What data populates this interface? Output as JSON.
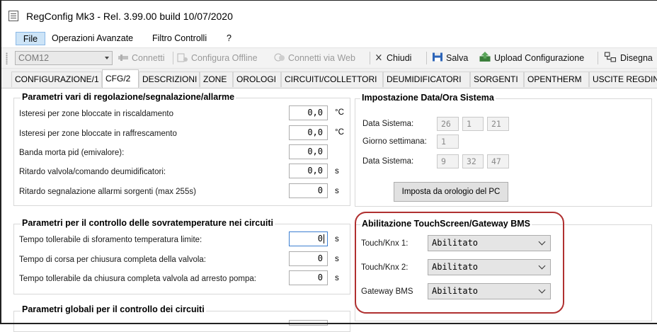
{
  "window": {
    "title": "RegConfig Mk3 - Rel. 3.99.00 build 10/07/2020"
  },
  "menu": {
    "items": [
      "File",
      "Operazioni Avanzate",
      "Filtro Controlli",
      "?"
    ]
  },
  "toolbar": {
    "port_value": "COM12",
    "connect": "Connetti",
    "configure_offline": "Configura Offline",
    "connect_web": "Connetti via Web",
    "close": "Chiudi",
    "save": "Salva",
    "upload": "Upload Configurazione",
    "draw": "Disegna"
  },
  "tabs": [
    "CONFIGURAZIONE/1",
    "CFG/2",
    "DESCRIZIONI",
    "ZONE",
    "OROLOGI",
    "CIRCUITI/COLLETTORI",
    "DEUMIDIFICATORI",
    "SORGENTI",
    "OPENTHERM",
    "USCITE REGDIN"
  ],
  "active_tab": "CFG/2",
  "group_params": {
    "title": "Parametri vari di regolazione/segnalazione/allarme",
    "rows": [
      {
        "label": "Isteresi per zone bloccate in riscaldamento",
        "value": "0,0",
        "unit": "°C"
      },
      {
        "label": "Isteresi per zone bloccate in raffrescamento",
        "value": "0,0",
        "unit": "°C"
      },
      {
        "label": "Banda morta pid (emivalore):",
        "value": "0,0",
        "unit": ""
      },
      {
        "label": "Ritardo valvola/comando deumidificatori:",
        "value": "0,0",
        "unit": "s"
      },
      {
        "label": "Ritardo segnalazione allarmi sorgenti (max 255s)",
        "value": "0",
        "unit": "s"
      }
    ]
  },
  "group_overtemp": {
    "title": "Parametri per il controllo delle sovratemperature nei circuiti",
    "rows": [
      {
        "label": "Tempo tollerabile di sforamento temperatura limite:",
        "value": "0",
        "unit": "s"
      },
      {
        "label": "Tempo di corsa per chiusura completa della valvola:",
        "value": "0",
        "unit": "s"
      },
      {
        "label": "Tempo tollerabile da chiusura completa valvola ad arresto pompa:",
        "value": "0",
        "unit": "s"
      }
    ]
  },
  "group_global": {
    "title": "Parametri globali per il controllo dei circuiti"
  },
  "group_datetime": {
    "title": "Impostazione Data/Ora Sistema",
    "date_label": "Data Sistema:",
    "date": [
      "26",
      "1",
      "21"
    ],
    "weekday_label": "Giorno settimana:",
    "weekday": "1",
    "time_label": "Data Sistema:",
    "time": [
      "9",
      "32",
      "47"
    ],
    "set_button": "Imposta da orologio del PC"
  },
  "group_touch": {
    "title": "Abilitazione TouchScreen/Gateway BMS",
    "rows": [
      {
        "label": "Touch/Knx 1:",
        "value": "Abilitato"
      },
      {
        "label": "Touch/Knx 2:",
        "value": "Abilitato"
      },
      {
        "label": "Gateway BMS",
        "value": "Abilitato"
      }
    ]
  },
  "colors": {
    "highlight": "#b03030",
    "menu_selected": "#cde4f7"
  }
}
